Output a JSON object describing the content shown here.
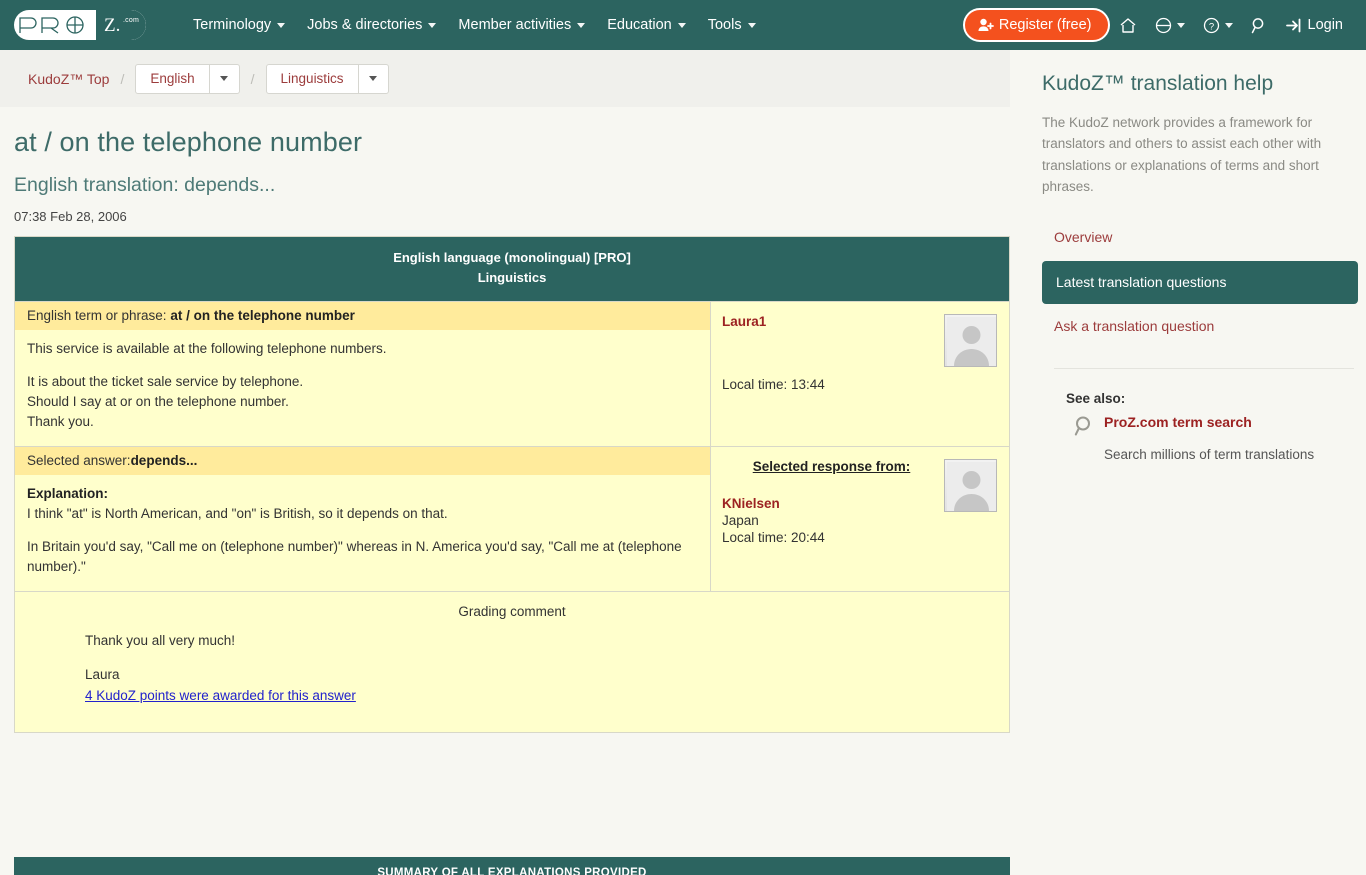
{
  "navbar": {
    "logo": {
      "pro": "PRO",
      "z": "Z.",
      "com": ".com"
    },
    "menu": [
      {
        "label": "Terminology",
        "icon": "chevron-down-icon"
      },
      {
        "label": "Jobs & directories",
        "icon": "chevron-down-icon"
      },
      {
        "label": "Member activities",
        "icon": "chevron-down-icon"
      },
      {
        "label": "Education",
        "icon": "chevron-down-icon"
      },
      {
        "label": "Tools",
        "icon": "chevron-down-icon"
      }
    ],
    "register_label": "Register (free)",
    "register_color": "#f4511e",
    "login_label": "Login",
    "icons": [
      "home-icon",
      "globe-icon",
      "help-icon",
      "search-icon",
      "login-icon"
    ]
  },
  "breadcrumb": {
    "root": "KudoZ™ Top",
    "separator": "/",
    "language": "English",
    "field": "Linguistics"
  },
  "page": {
    "title": "at / on the telephone number",
    "subtitle": "English translation: depends...",
    "timestamp": "07:38 Feb 28, 2006"
  },
  "qa": {
    "header_line1": "English language (monolingual) [PRO]",
    "header_line2": "Linguistics",
    "header_bg": "#2c6460",
    "cell_bg": "#ffffcc",
    "highlight_bg": "#ffeb9c",
    "question": {
      "label": "English term or phrase:",
      "term": "at / on the telephone number",
      "body_lines": [
        "This service is available at the following telephone numbers.",
        "",
        "It is about the ticket sale service by telephone.",
        "Should I say at or on the telephone number.",
        "Thank you."
      ],
      "asker": {
        "name": "Laura1",
        "local_time": "Local time: 13:44",
        "avatar": "default-avatar-icon"
      }
    },
    "answer": {
      "label": "Selected answer:",
      "term": "depends...",
      "explanation_label": "Explanation:",
      "body_lines": [
        "I think \"at\" is North American, and \"on\" is British, so it depends on that.",
        "",
        "In Britain you'd say, \"Call me on (telephone number)\" whereas in N. America you'd say, \"Call me at (telephone number).\""
      ],
      "responder": {
        "header": "Selected response from:",
        "name": "KNielsen",
        "country": "Japan",
        "local_time": "Local time: 20:44",
        "avatar": "default-avatar-icon"
      }
    },
    "grading": {
      "title": "Grading comment",
      "lines": [
        "Thank you all very much!",
        "",
        "Laura"
      ],
      "points_link": "4 KudoZ points were awarded for this answer"
    }
  },
  "summary_bar": {
    "label": "SUMMARY OF ALL EXPLANATIONS PROVIDED"
  },
  "sidebar": {
    "title": "KudoZ™ translation help",
    "description": "The KudoZ network provides a framework for translators and others to assist each other with translations or explanations of terms and short phrases.",
    "overview_label": "Overview",
    "banner_label": "Latest translation questions",
    "banner_color": "#2c6460",
    "ask_label": "Ask a translation question",
    "see_also_label": "See also:",
    "tool_link": "ProZ.com term search",
    "tool_icon": "search-icon",
    "tool_sub": "Search millions of term translations"
  }
}
